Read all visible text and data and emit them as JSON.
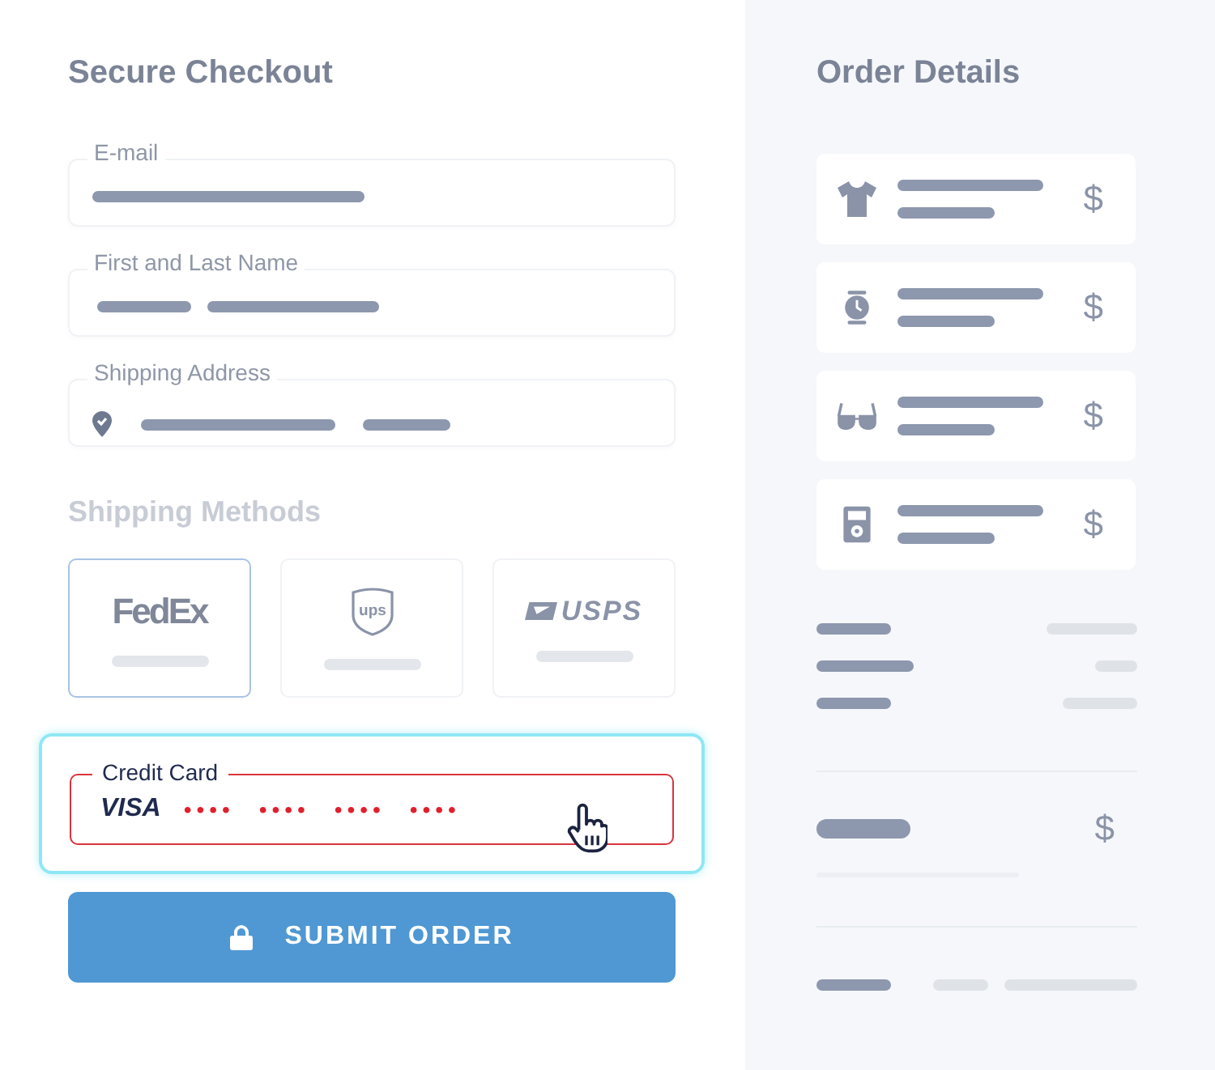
{
  "checkout": {
    "title": "Secure Checkout",
    "fields": [
      {
        "label": "E-mail",
        "kind": "email"
      },
      {
        "label": "First and Last Name",
        "kind": "name"
      },
      {
        "label": "Shipping Address",
        "kind": "address"
      }
    ],
    "shipping_title": "Shipping Methods",
    "shipping_methods": [
      {
        "label": "FedEx",
        "kind": "fedex",
        "selected": true
      },
      {
        "label": "ups",
        "kind": "ups",
        "selected": false
      },
      {
        "label": "USPS",
        "kind": "usps",
        "selected": false
      }
    ],
    "card": {
      "label": "Credit Card",
      "brand": "VISA",
      "number": "•••• •••• •••• ••••",
      "focused": true,
      "error": true
    },
    "submit": "SUBMIT ORDER"
  },
  "order": {
    "title": "Order Details",
    "items": [
      {
        "kind": "shirt",
        "price": "$"
      },
      {
        "kind": "watch",
        "price": "$"
      },
      {
        "kind": "glasses",
        "price": "$"
      },
      {
        "kind": "player",
        "price": "$"
      }
    ],
    "total_price": "$"
  }
}
